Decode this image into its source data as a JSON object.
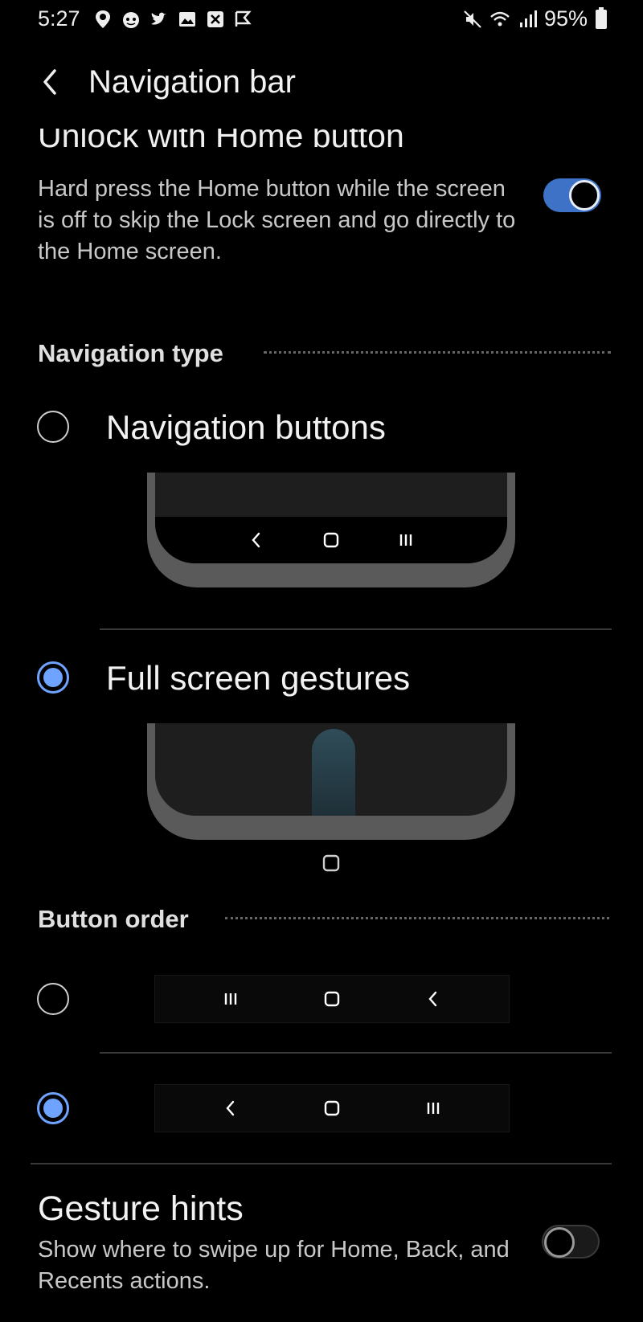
{
  "status_bar": {
    "time": "5:27",
    "battery": "95%"
  },
  "header": {
    "title": "Navigation bar"
  },
  "unlock": {
    "title": "Unlock with Home button",
    "description": "Hard press the Home button while the screen is off to skip the Lock screen and go directly to the Home screen.",
    "enabled": true
  },
  "navigation_type": {
    "header": "Navigation type",
    "options": [
      {
        "label": "Navigation buttons",
        "selected": false
      },
      {
        "label": "Full screen gestures",
        "selected": true
      }
    ]
  },
  "button_order": {
    "header": "Button order",
    "options": [
      {
        "order": [
          "recents",
          "home",
          "back"
        ],
        "selected": false
      },
      {
        "order": [
          "back",
          "home",
          "recents"
        ],
        "selected": true
      }
    ]
  },
  "gesture_hints": {
    "title": "Gesture hints",
    "description": "Show where to swipe up for Home, Back, and Recents actions.",
    "enabled": false
  },
  "colors": {
    "background": "#000000",
    "accent": "#6ea3ff",
    "toggle_on": "#3d72c7"
  }
}
